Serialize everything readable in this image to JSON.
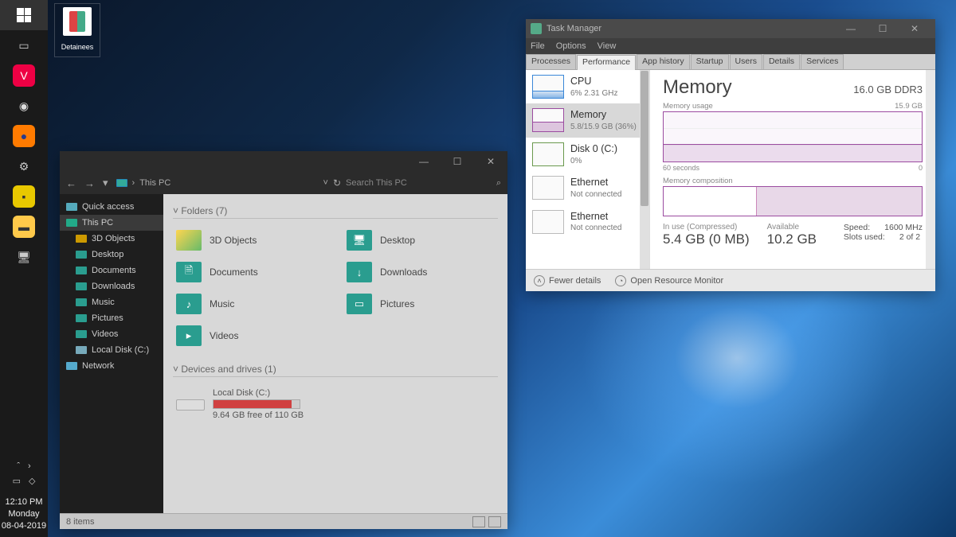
{
  "taskbar": {
    "icons": [
      {
        "name": "start",
        "glyph": "win"
      },
      {
        "name": "task-view",
        "glyph": "▭",
        "bg": "transparent",
        "color": "#ccc"
      },
      {
        "name": "vivaldi",
        "glyph": "V",
        "bg": "#e04",
        "color": "#fff"
      },
      {
        "name": "chrome",
        "glyph": "◉",
        "bg": "transparent",
        "color": "#ddd"
      },
      {
        "name": "firefox",
        "glyph": "●",
        "bg": "#ff7b00",
        "color": "#2a3a8a"
      },
      {
        "name": "settings",
        "glyph": "⚙",
        "bg": "transparent",
        "color": "#ccc"
      },
      {
        "name": "sticky",
        "glyph": "▪",
        "bg": "#e8c800",
        "color": "#333"
      },
      {
        "name": "explorer",
        "glyph": "▬",
        "bg": "#ffc94a",
        "color": "#333"
      },
      {
        "name": "thispc",
        "glyph": "🖥",
        "bg": "transparent",
        "color": "#ccc"
      }
    ],
    "tray": {
      "battery": "▭",
      "wifi": "◇",
      "up": "ˆ",
      "right": "›"
    },
    "clock": {
      "time": "12:10 PM",
      "day": "Monday",
      "date": "08-04-2019"
    }
  },
  "desktop": {
    "icon_label": "Detainees"
  },
  "explorer": {
    "titlebar": {
      "min": "—",
      "max": "☐",
      "close": "✕"
    },
    "addr": {
      "back": "←",
      "fwd": "→",
      "chev": "▾",
      "sep": "›",
      "location": "This PC",
      "refresh": "↻",
      "search_placeholder": "Search This PC"
    },
    "sidebar": [
      {
        "label": "Quick access",
        "ico": "#5ab",
        "sub": false,
        "active": false
      },
      {
        "label": "This PC",
        "ico": "#2a8",
        "sub": false,
        "active": true
      },
      {
        "label": "3D Objects",
        "ico": "#c90",
        "sub": true,
        "active": false
      },
      {
        "label": "Desktop",
        "ico": "#2a9d8f",
        "sub": true,
        "active": false
      },
      {
        "label": "Documents",
        "ico": "#2a9d8f",
        "sub": true,
        "active": false
      },
      {
        "label": "Downloads",
        "ico": "#2a9d8f",
        "sub": true,
        "active": false
      },
      {
        "label": "Music",
        "ico": "#2a9d8f",
        "sub": true,
        "active": false
      },
      {
        "label": "Pictures",
        "ico": "#2a9d8f",
        "sub": true,
        "active": false
      },
      {
        "label": "Videos",
        "ico": "#2a9d8f",
        "sub": true,
        "active": false
      },
      {
        "label": "Local Disk (C:)",
        "ico": "#7ab",
        "sub": true,
        "active": false
      },
      {
        "label": "Network",
        "ico": "#5ac",
        "sub": false,
        "active": false
      }
    ],
    "sections": {
      "folders": "Folders (7)",
      "drives": "Devices and drives (1)"
    },
    "folders": [
      {
        "label": "3D Objects",
        "cls": "fico-yellow",
        "glyph": ""
      },
      {
        "label": "Desktop",
        "cls": "fico-teal",
        "glyph": "🖥"
      },
      {
        "label": "Documents",
        "cls": "fico-teal",
        "glyph": "🗎"
      },
      {
        "label": "Downloads",
        "cls": "fico-teal",
        "glyph": "↓"
      },
      {
        "label": "Music",
        "cls": "fico-teal",
        "glyph": "♪"
      },
      {
        "label": "Pictures",
        "cls": "fico-teal",
        "glyph": "▭"
      },
      {
        "label": "Videos",
        "cls": "fico-teal",
        "glyph": "▸"
      }
    ],
    "drive": {
      "label": "Local Disk (C:)",
      "free_text": "9.64 GB free of 110 GB",
      "fill_pct": 91
    },
    "status": {
      "items": "8 items"
    }
  },
  "taskmgr": {
    "title": "Task Manager",
    "titlebar": {
      "min": "—",
      "max": "☐",
      "close": "✕"
    },
    "menu": [
      "File",
      "Options",
      "View"
    ],
    "tabs": [
      "Processes",
      "Performance",
      "App history",
      "Startup",
      "Users",
      "Details",
      "Services"
    ],
    "active_tab": 1,
    "left": [
      {
        "key": "cpu",
        "label": "CPU",
        "sub": "6%  2.31 GHz"
      },
      {
        "key": "mem",
        "label": "Memory",
        "sub": "5.8/15.9 GB (36%)"
      },
      {
        "key": "disk",
        "label": "Disk 0 (C:)",
        "sub": "0%"
      },
      {
        "key": "eth",
        "label": "Ethernet",
        "sub": "Not connected"
      },
      {
        "key": "eth",
        "label": "Ethernet",
        "sub": "Not connected"
      }
    ],
    "right": {
      "title": "Memory",
      "spec": "16.0 GB DDR3",
      "usage_label": "Memory usage",
      "usage_max": "15.9 GB",
      "axis_left": "60 seconds",
      "axis_right": "0",
      "comp_label": "Memory composition",
      "stats": {
        "inuse_label": "In use (Compressed)",
        "inuse_val": "5.4 GB (0 MB)",
        "avail_label": "Available",
        "avail_val": "10.2 GB",
        "speed_label": "Speed:",
        "speed_val": "1600 MHz",
        "slots_label": "Slots used:",
        "slots_val": "2 of 2"
      }
    },
    "footer": {
      "fewer": "Fewer details",
      "monitor": "Open Resource Monitor"
    }
  }
}
